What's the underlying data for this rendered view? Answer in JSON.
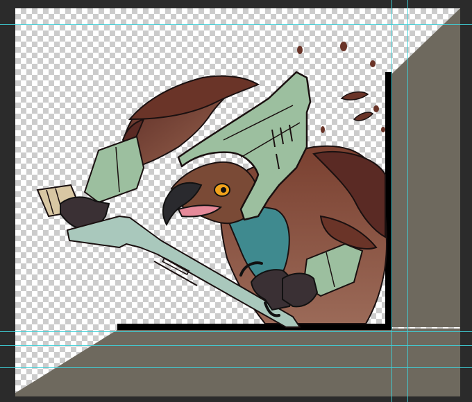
{
  "canvas": {
    "colors": {
      "workspace": "#2b2b2b",
      "checker_light": "#ffffff",
      "checker_dark": "#cccccc",
      "backdrop_panel": "#6e695e",
      "frame_border": "#000000",
      "guide": "#3fd0d8",
      "helmet": "#9cbf9f",
      "sword_blade": "#a9c8bc",
      "feathers_dark": "#5a2a24",
      "feathers_light": "#8a5a48",
      "scarf": "#3f8a8f",
      "eye": "#f0a21c",
      "beak": "#2a2a2e",
      "hilt_wrap": "#d8c7a3",
      "gauntlet": "#3a3034"
    },
    "icons": [
      "eagle-knight-illustration"
    ],
    "guides": {
      "horizontal_count": 4,
      "vertical_count": 2
    }
  }
}
